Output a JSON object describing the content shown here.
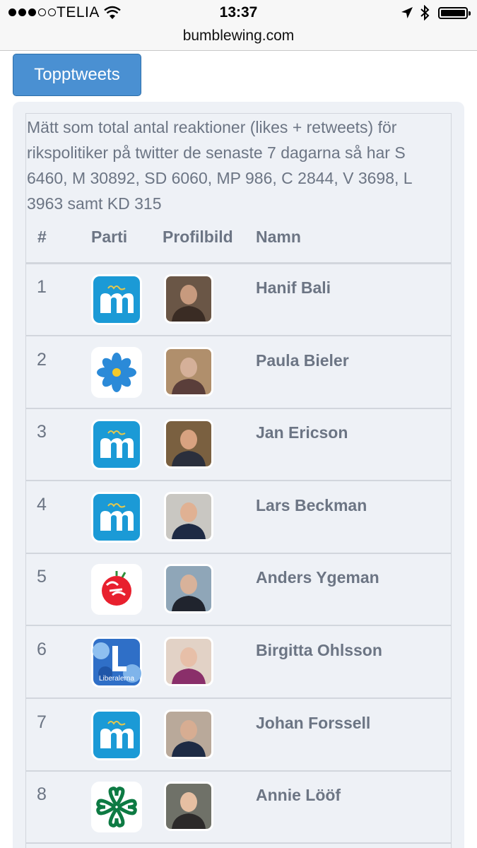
{
  "status": {
    "carrier": "TELIA",
    "time": "13:37",
    "battery_level": 1.0
  },
  "browser": {
    "url": "bumblewing.com"
  },
  "page": {
    "button_label": "Topptweets",
    "intro": "Mätt som total antal reaktioner (likes + retweets) för rikspolitiker på twitter de senaste 7 dagarna så har S 6460, M 30892, SD 6060, MP 986, C 2844, V 3698, L 3963 samt KD 315",
    "columns": {
      "rank": "#",
      "party": "Parti",
      "photo": "Profilbild",
      "name": "Namn"
    },
    "colors": {
      "accent": "#4a90d2",
      "text": "#6c7584",
      "panel": "#eef1f6",
      "m_blue": "#1b9ad6",
      "sd_blue": "#2b8ad8",
      "s_red": "#e8202e",
      "c_green": "#0d7a43"
    },
    "rows": [
      {
        "rank": "1",
        "party_icon": "moderaterna-logo",
        "photo_icon": "profile-photo",
        "name": "Hanif Bali"
      },
      {
        "rank": "2",
        "party_icon": "sverigedemokraterna-logo",
        "photo_icon": "profile-photo",
        "name": "Paula Bieler"
      },
      {
        "rank": "3",
        "party_icon": "moderaterna-logo",
        "photo_icon": "profile-photo",
        "name": "Jan Ericson"
      },
      {
        "rank": "4",
        "party_icon": "moderaterna-logo",
        "photo_icon": "profile-photo",
        "name": "Lars Beckman"
      },
      {
        "rank": "5",
        "party_icon": "socialdemokraterna-logo",
        "photo_icon": "profile-photo",
        "name": "Anders Ygeman"
      },
      {
        "rank": "6",
        "party_icon": "liberalerna-logo",
        "party_text": "Liberalerna",
        "photo_icon": "profile-photo",
        "name": "Birgitta Ohlsson"
      },
      {
        "rank": "7",
        "party_icon": "moderaterna-logo",
        "photo_icon": "profile-photo",
        "name": "Johan Forssell"
      },
      {
        "rank": "8",
        "party_icon": "centerpartiet-logo",
        "photo_icon": "profile-photo",
        "name": "Annie Lööf"
      }
    ]
  }
}
